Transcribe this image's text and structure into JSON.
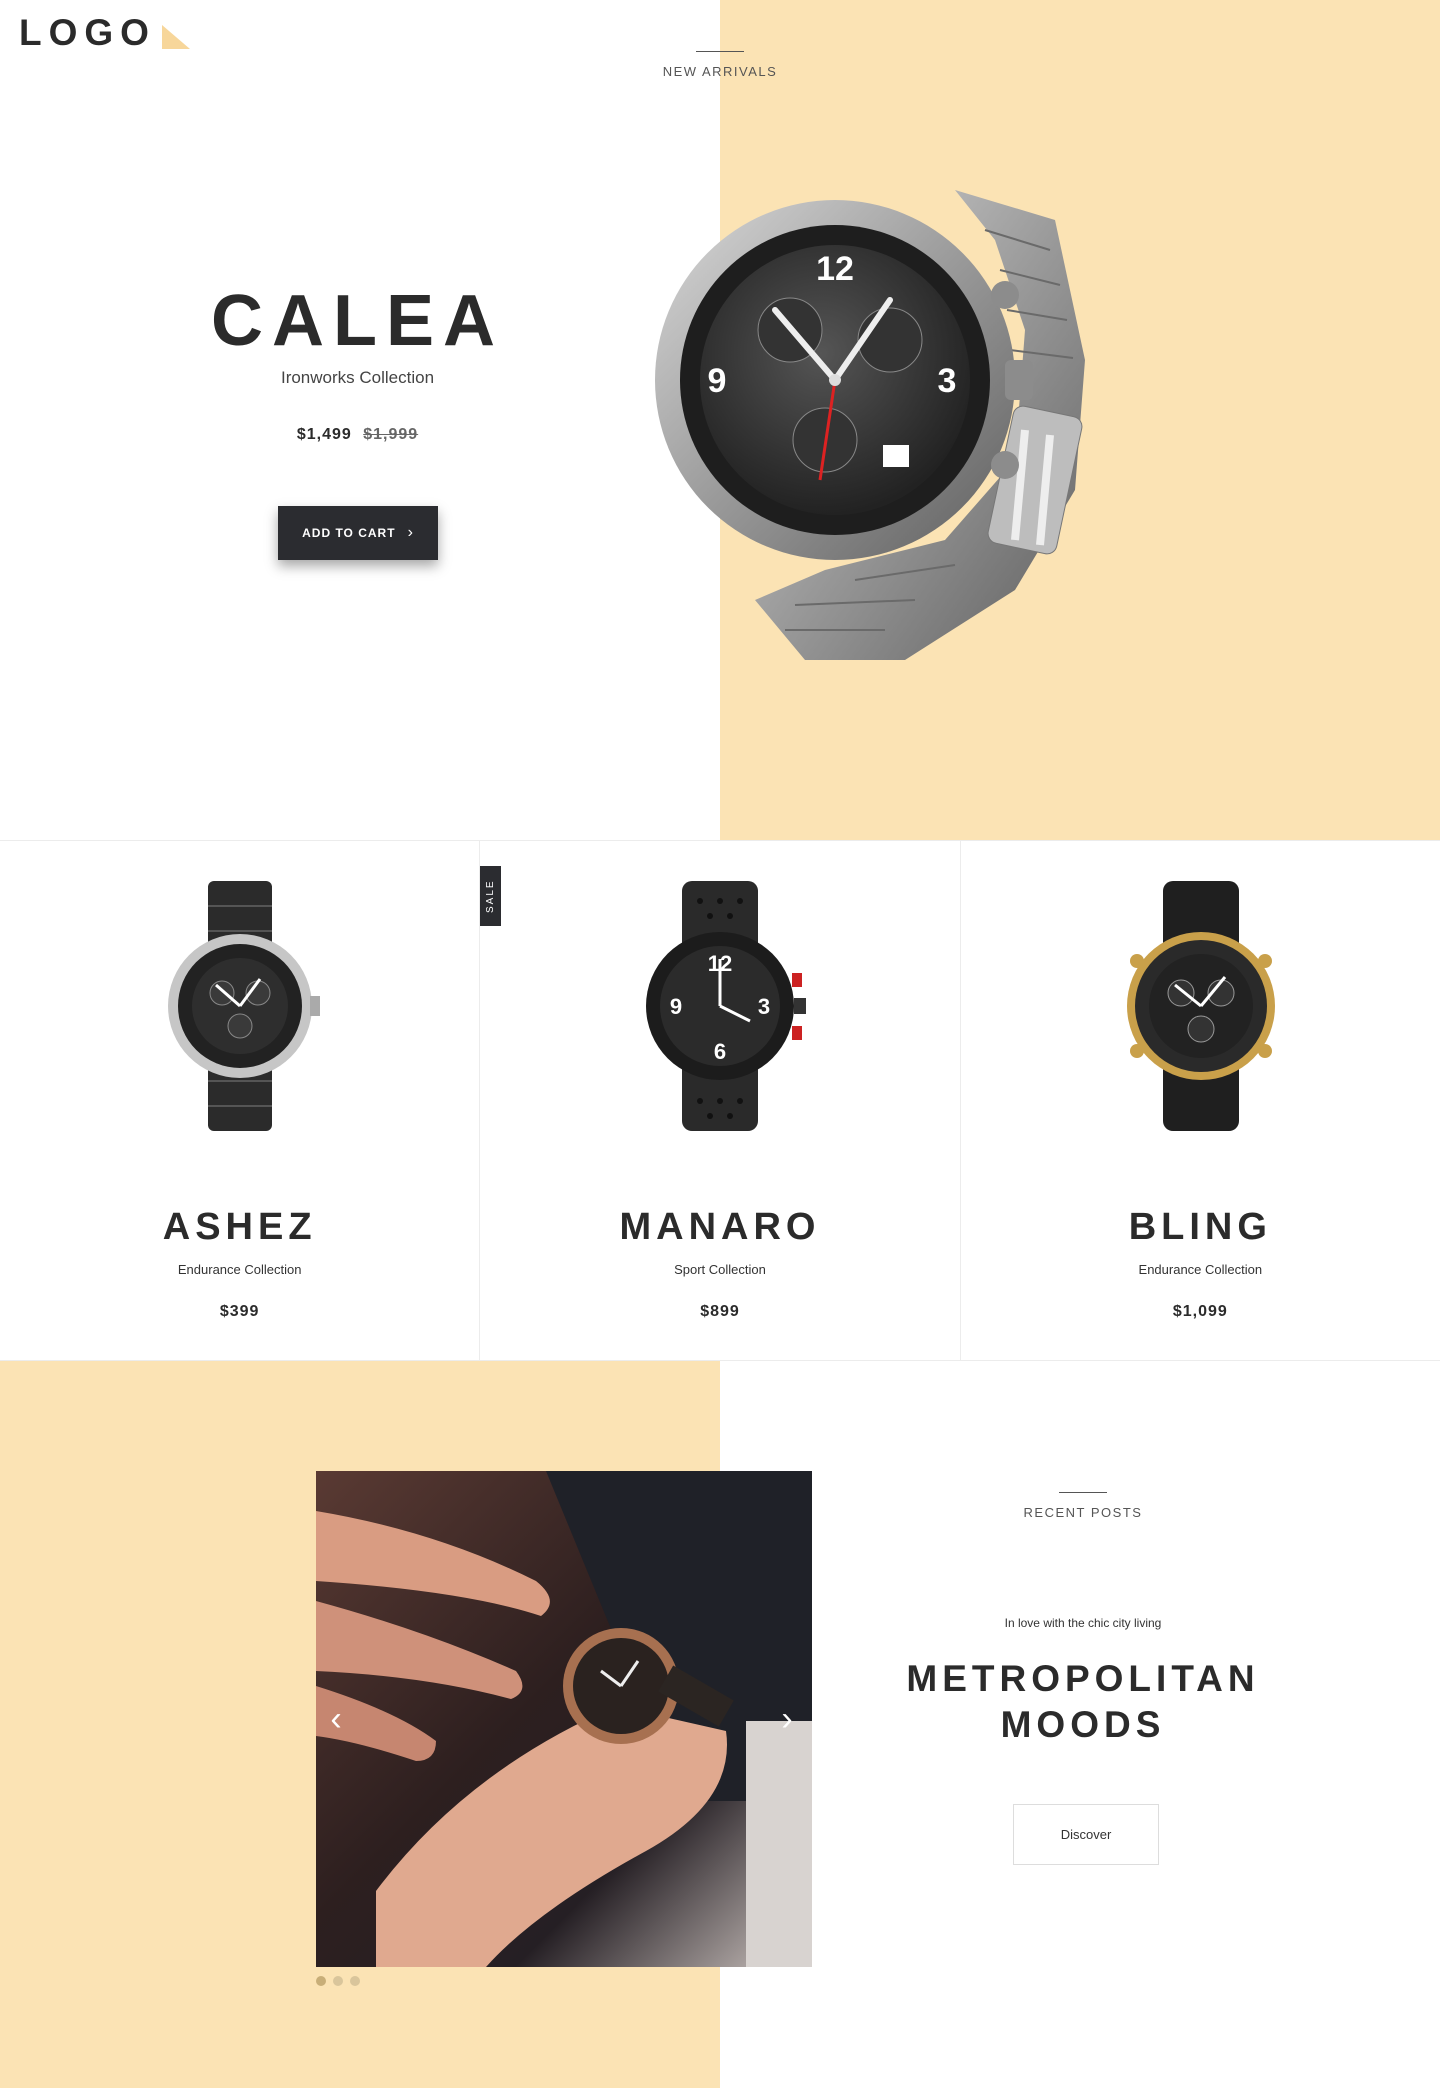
{
  "logo": {
    "text": "LOGO"
  },
  "colors": {
    "accent": "#fbe3b4",
    "dark": "#2b2c30"
  },
  "hero": {
    "eyebrow": "NEW ARRIVALS",
    "title": "CALEA",
    "subtitle": "Ironworks Collection",
    "price": "$1,499",
    "old_price": "$1,999",
    "cta_label": "ADD TO CART",
    "cta_icon": "chevron-right-icon"
  },
  "products": [
    {
      "name": "ASHEZ",
      "collection": "Endurance Collection",
      "price": "$399"
    },
    {
      "name": "MANARO",
      "collection": "Sport Collection",
      "price": "$899",
      "badge": "SALE"
    },
    {
      "name": "BLING",
      "collection": "Endurance Collection",
      "price": "$1,099"
    }
  ],
  "blog": {
    "eyebrow": "RECENT POSTS",
    "kicker": "In love with the chic city living",
    "title_line1": "METROPOLITAN",
    "title_line2": "MOODS",
    "cta_label": "Discover",
    "slider_dots": 3,
    "active_dot": 0
  }
}
